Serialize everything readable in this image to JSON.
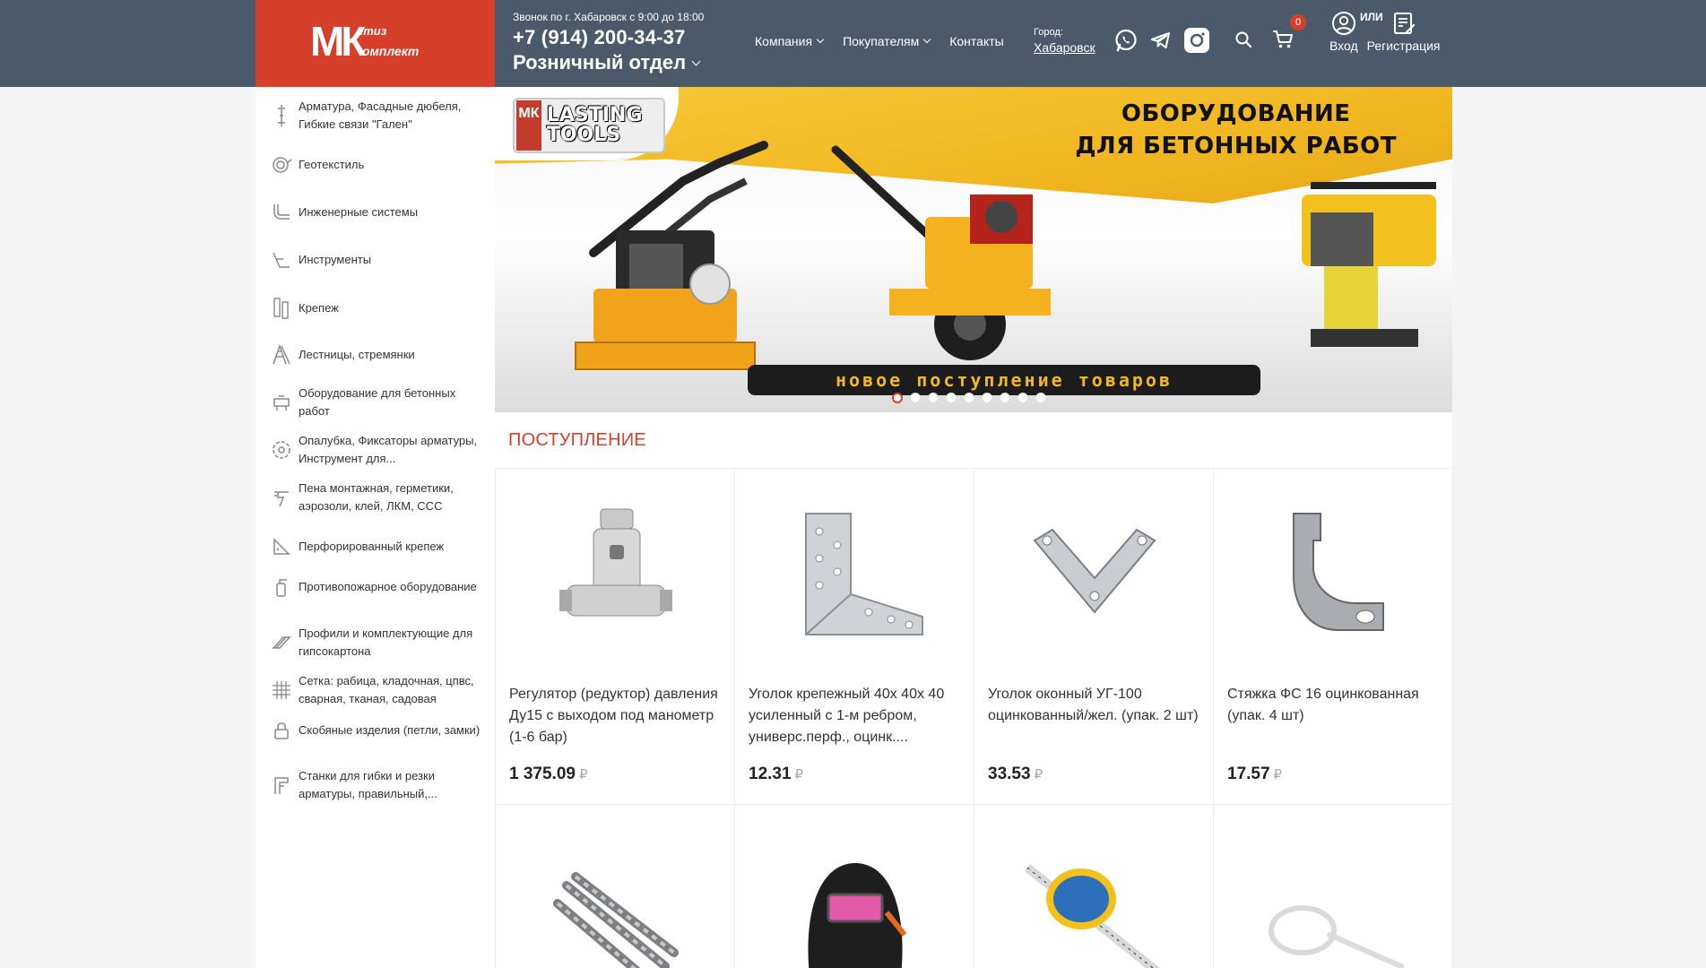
{
  "header": {
    "logo": {
      "line1": "етиз",
      "line2": "омплект",
      "mark": "МК"
    },
    "hours": "Звонок по г. Хабаровск с 9:00 до 18:00",
    "phone": "+7 (914) 200-34-37",
    "department": "Розничный отдел",
    "nav": [
      {
        "label": "Компания"
      },
      {
        "label": "Покупателям"
      },
      {
        "label": "Контакты"
      }
    ],
    "city_label": "Город:",
    "city": "Хабаровск",
    "cart_count": "0",
    "or_label": "ИЛИ",
    "login": "Вход",
    "register": "Регистрация",
    "icons": [
      "whatsapp-icon",
      "telegram-icon",
      "instagram-icon",
      "search-icon",
      "cart-icon",
      "user-icon",
      "register-icon"
    ],
    "colors": {
      "header_bg": "#4b5a6a",
      "brand_red": "#d6402b"
    }
  },
  "sidebar": {
    "items": [
      {
        "label": "Арматура, Фасадные дюбеля, Гибкие связи \"Гален\"",
        "icon": "rebar-icon"
      },
      {
        "label": "Геотекстиль",
        "icon": "geotextile-icon"
      },
      {
        "label": "Инженерные системы",
        "icon": "pipe-icon"
      },
      {
        "label": "Инструменты",
        "icon": "tools-icon"
      },
      {
        "label": "Крепеж",
        "icon": "fastener-icon"
      },
      {
        "label": "Лестницы, стремянки",
        "icon": "ladder-icon"
      },
      {
        "label": "Оборудование для бетонных работ",
        "icon": "concrete-icon"
      },
      {
        "label": "Опалубка, Фиксаторы арматуры, Инструмент для...",
        "icon": "formwork-icon"
      },
      {
        "label": "Пена монтажная, герметики, аэрозоли, клей, ЛКМ, ССС",
        "icon": "foam-gun-icon"
      },
      {
        "label": "Перфорированный крепеж",
        "icon": "perforated-icon"
      },
      {
        "label": "Противопожарное оборудование",
        "icon": "fire-icon"
      },
      {
        "label": "Профили и комплектующие для гипсокартона",
        "icon": "profile-icon"
      },
      {
        "label": "Сетка: рабица, кладочная, цпвс, сварная, тканая, садовая",
        "icon": "mesh-icon"
      },
      {
        "label": "Скобяные изделия (петли, замки)",
        "icon": "lock-icon"
      },
      {
        "label": "Станки для гибки и резки арматуры, правильный,...",
        "icon": "machine-icon"
      }
    ]
  },
  "banner": {
    "brand": "LASTING TOOLS",
    "brand_mark": "МК",
    "title_line1": "ОБОРУДОВАНИЕ",
    "title_line2": "ДЛЯ БЕТОННЫХ РАБОТ",
    "strip": "новое поступление товаров",
    "slides": 9,
    "active_slide": 1
  },
  "section": {
    "title": "ПОСТУПЛЕНИЕ"
  },
  "products": [
    {
      "name": "Регулятор (редуктор) давления Ду15 с выходом под манометр (1-6 бар)",
      "price": "1 375.09",
      "currency": "₽",
      "icon": "pressure-regulator-image"
    },
    {
      "name": "Уголок крепежный 40х 40х 40 усиленный с 1-м ребром, универс.перф., оцинк....",
      "price": "12.31",
      "currency": "₽",
      "icon": "angle-bracket-image"
    },
    {
      "name": "Уголок оконный УГ-100 оцинкованный/жел. (упак. 2 шт)",
      "price": "33.53",
      "currency": "₽",
      "icon": "window-angle-image"
    },
    {
      "name": "Стяжка ФС 16 оцинкованная (упак. 4 шт)",
      "price": "17.57",
      "currency": "₽",
      "icon": "tie-bracket-image"
    },
    {
      "name": "",
      "price": "",
      "currency": "",
      "icon": "drill-bits-image"
    },
    {
      "name": "",
      "price": "",
      "currency": "",
      "icon": "welding-helmet-image"
    },
    {
      "name": "",
      "price": "",
      "currency": "",
      "icon": "tape-measure-image"
    },
    {
      "name": "",
      "price": "",
      "currency": "",
      "icon": "cable-tie-image"
    }
  ]
}
